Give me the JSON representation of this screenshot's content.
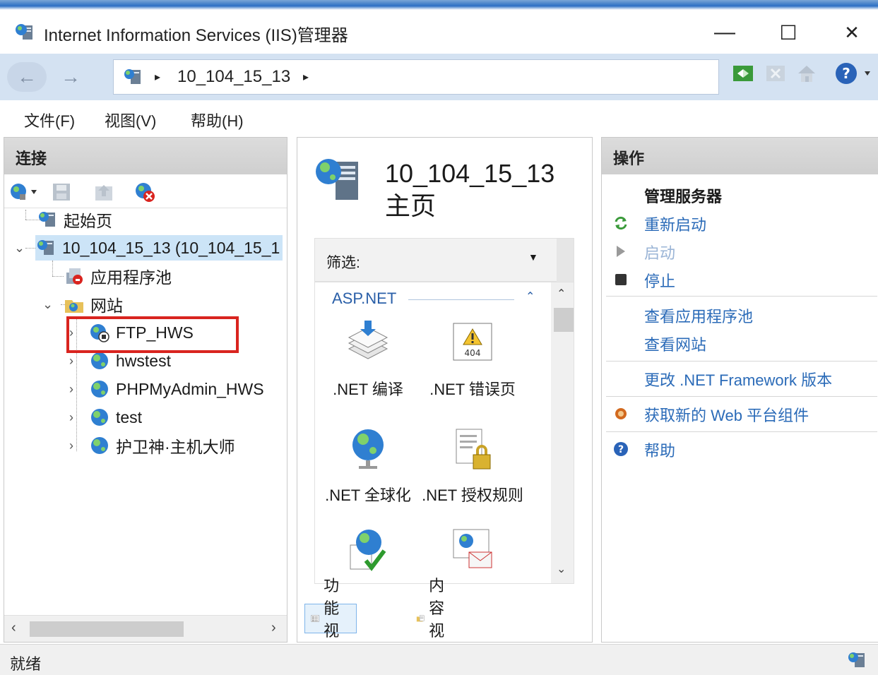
{
  "window": {
    "title": "Internet Information Services (IIS)管理器",
    "minimize": "—",
    "maximize": "☐",
    "close": "✕"
  },
  "address": {
    "back": "←",
    "forward": "→",
    "crumb": "10_104_15_13",
    "arrow": "▸"
  },
  "menu": {
    "file": "文件(F)",
    "view": "视图(V)",
    "help": "帮助(H)"
  },
  "connections": {
    "header": "连接",
    "tree": {
      "start_page": "起始页",
      "server": "10_104_15_13 (10_104_15_1",
      "app_pools": "应用程序池",
      "sites": "网站",
      "site_items": [
        "FTP_HWS",
        "hwstest",
        "PHPMyAdmin_HWS",
        "test",
        "护卫神·主机大师"
      ]
    }
  },
  "home": {
    "title_line1": "10_104_15_13",
    "title_line2": "主页",
    "filter_label": "筛选:",
    "group": "ASP.NET",
    "features": [
      {
        "label": ".NET 编译",
        "icon": "net-compile-icon"
      },
      {
        "label": ".NET 错误页",
        "icon": "net-error-pages-icon"
      },
      {
        "label": ".NET 全球化",
        "icon": "net-globalization-icon"
      },
      {
        "label": ".NET 授权规则",
        "icon": "net-authorization-icon"
      }
    ],
    "feature_view": "功能视图",
    "content_view": "内容视图"
  },
  "actions": {
    "header": "操作",
    "section": "管理服务器",
    "restart": "重新启动",
    "start": "启动",
    "stop": "停止",
    "view_app_pools": "查看应用程序池",
    "view_sites": "查看网站",
    "change_net": "更改 .NET Framework 版本",
    "get_web_platform": "获取新的 Web 平台组件",
    "help": "帮助"
  },
  "status": {
    "text": "就绪"
  },
  "colors": {
    "link": "#2b6bb8",
    "address_bar": "#d4e2f2",
    "highlight": "#d9241f"
  }
}
